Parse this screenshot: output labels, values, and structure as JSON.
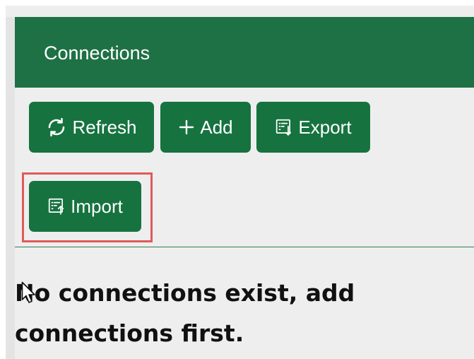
{
  "header": {
    "title": "Connections"
  },
  "toolbar": {
    "buttons": [
      {
        "label": "Refresh",
        "icon": "refresh-icon"
      },
      {
        "label": "Add",
        "icon": "plus-icon"
      },
      {
        "label": "Export",
        "icon": "export-icon"
      },
      {
        "label": "Import",
        "icon": "import-icon"
      }
    ]
  },
  "main": {
    "empty_message": "No connections exist, add connections first."
  },
  "colors": {
    "header_bg": "#1e7145",
    "button_bg": "#16733f",
    "page_bg": "#eeeeee",
    "highlight": "#e05a5a"
  }
}
